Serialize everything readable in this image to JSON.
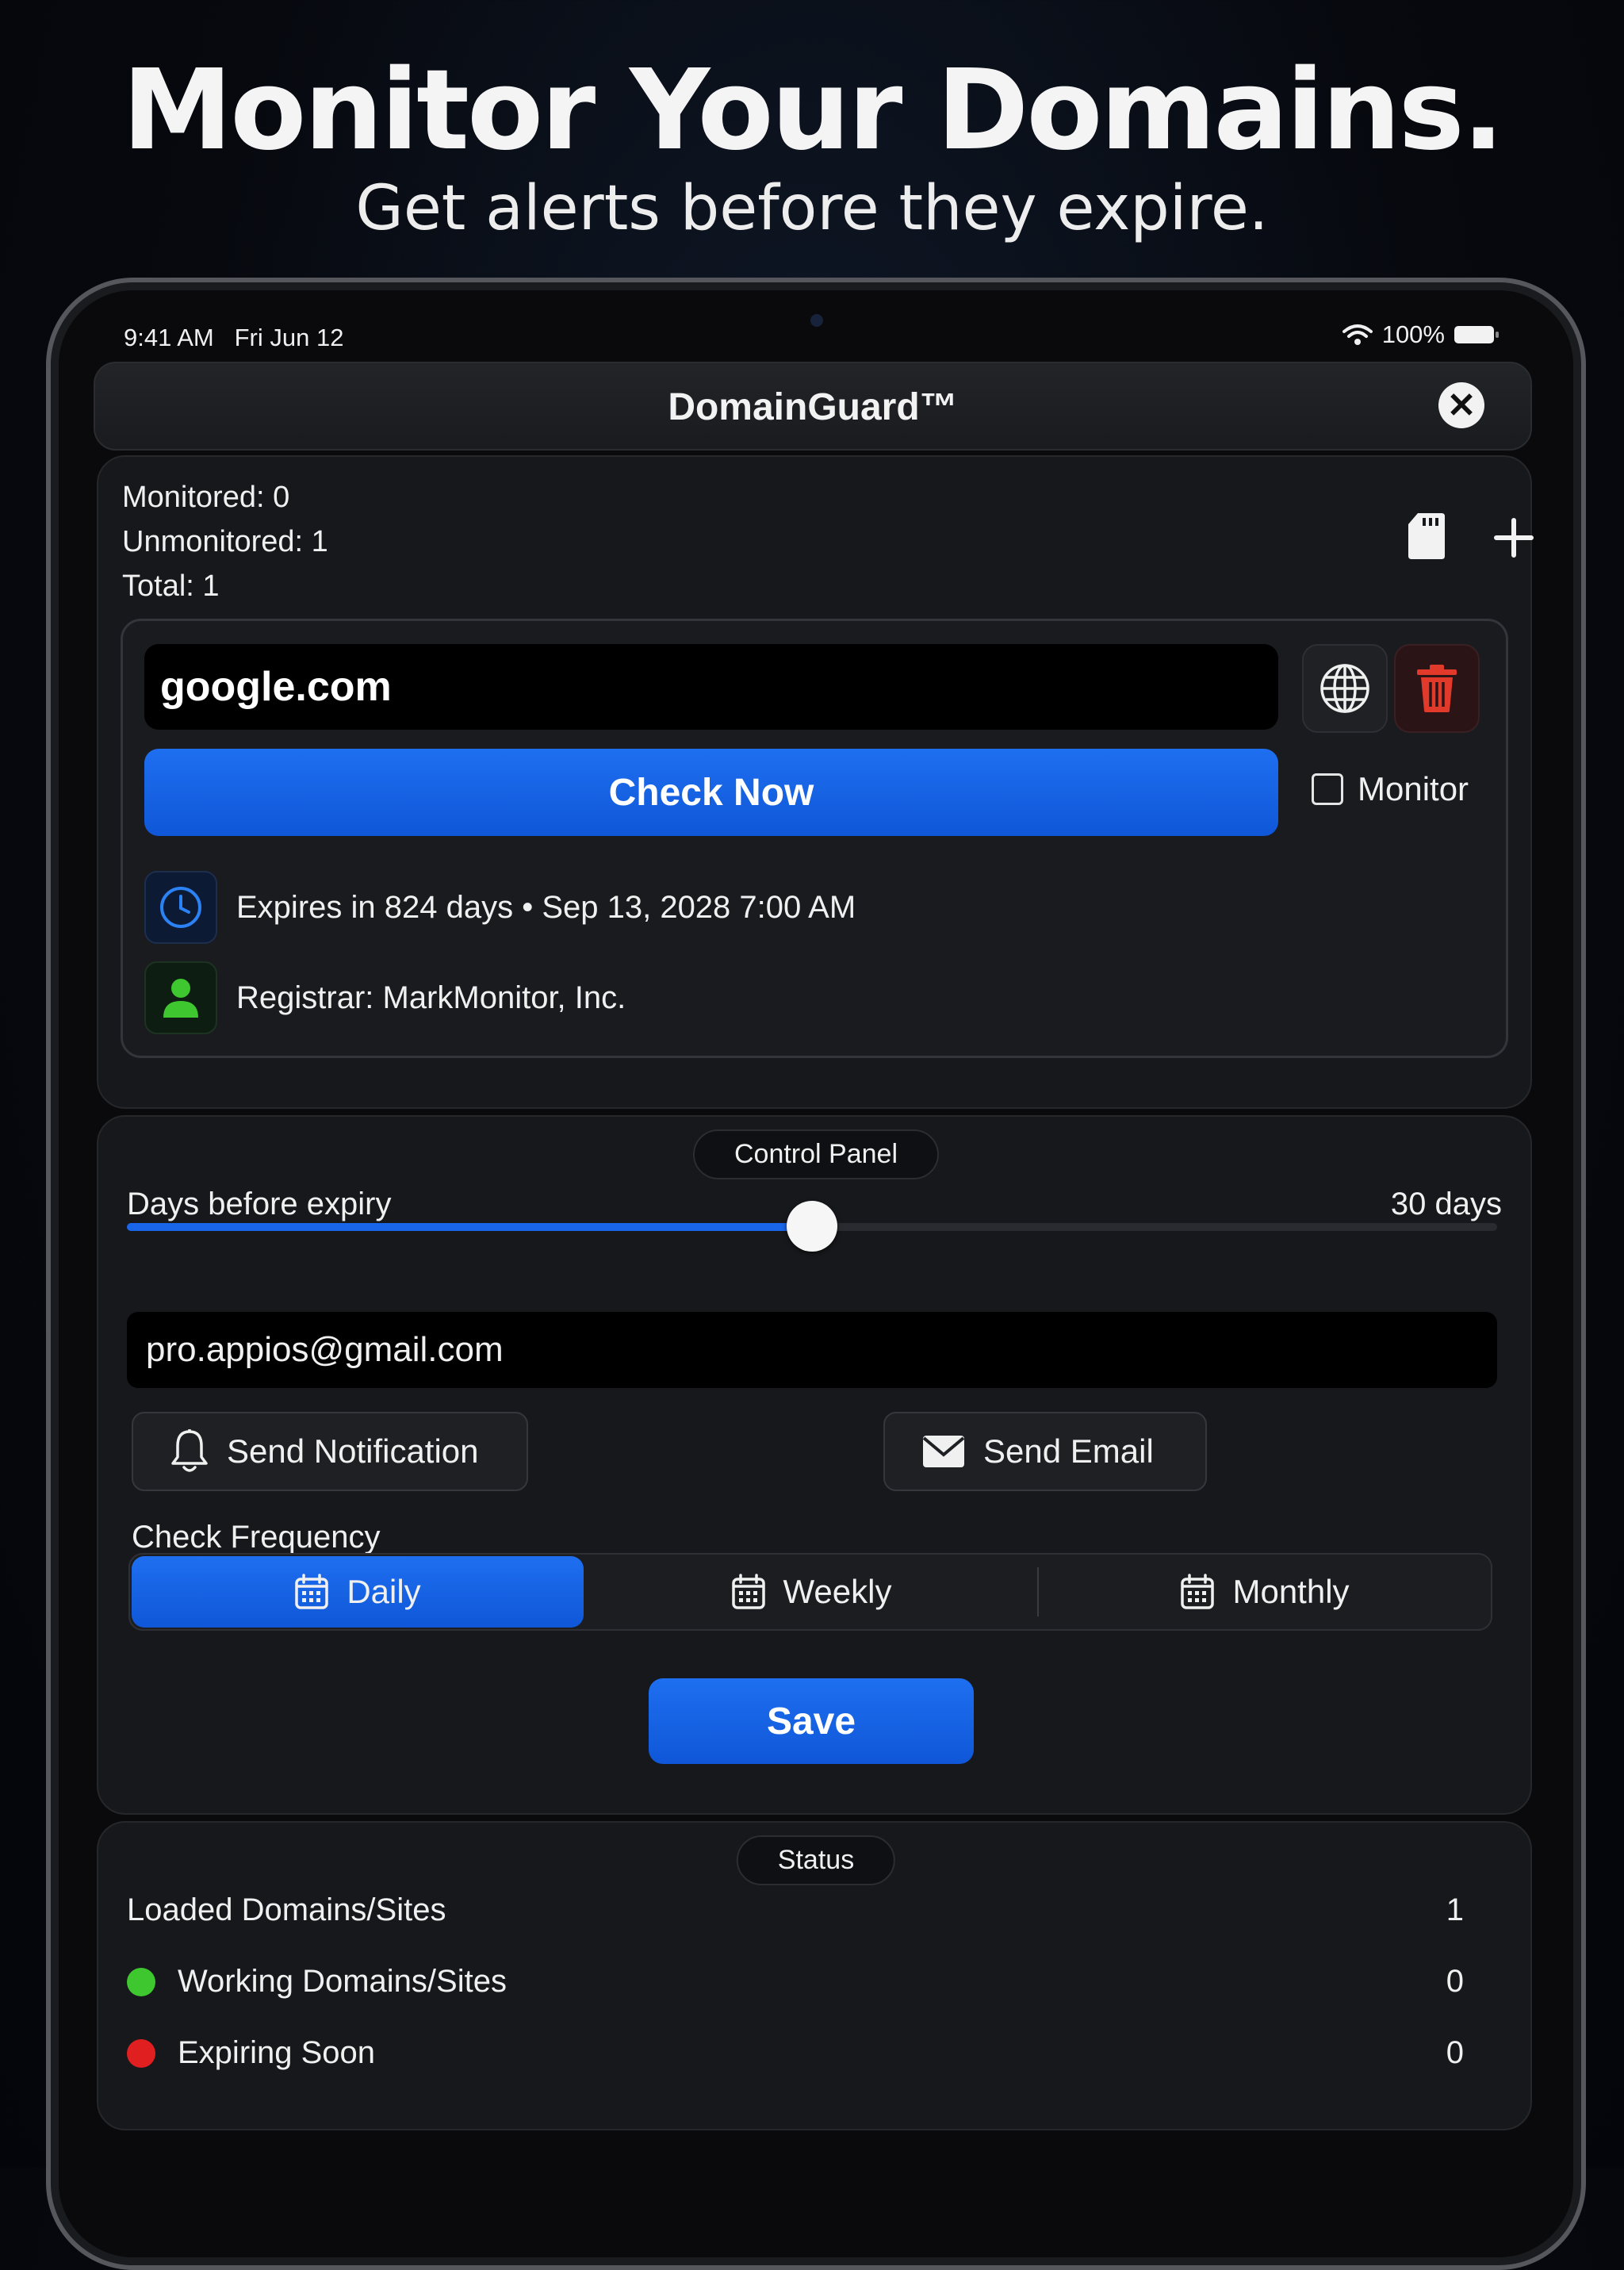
{
  "promo": {
    "headline": "Monitor Your Domains.",
    "subhead": "Get alerts before they expire."
  },
  "statusbar": {
    "time": "9:41 AM",
    "date": "Fri Jun 12",
    "battery": "100%"
  },
  "navbar": {
    "title": "DomainGuard™"
  },
  "summary": {
    "monitored": "Monitored: 0",
    "unmonitored": "Unmonitored: 1",
    "total": "Total: 1"
  },
  "domain_card": {
    "domain": "google.com",
    "check_label": "Check Now",
    "monitor_label": "Monitor",
    "monitor_checked": false,
    "expiry": "Expires in 824 days • Sep 13, 2028 7:00 AM",
    "registrar": "Registrar: MarkMonitor, Inc."
  },
  "control_panel": {
    "title": "Control Panel",
    "days_label": "Days before expiry",
    "days_value": "30 days",
    "slider_fraction": 0.5,
    "email": "pro.appios@gmail.com",
    "send_notification": "Send Notification",
    "send_email": "Send Email",
    "frequency_label": "Check Frequency",
    "frequency_options": [
      "Daily",
      "Weekly",
      "Monthly"
    ],
    "frequency_selected": "Daily",
    "save_label": "Save"
  },
  "status": {
    "title": "Status",
    "rows": [
      {
        "label": "Loaded Domains/Sites",
        "value": "1"
      },
      {
        "label": "Working Domains/Sites",
        "value": "0"
      },
      {
        "label": "Expiring Soon",
        "value": "0"
      }
    ]
  },
  "colors": {
    "accent": "#1a66e8",
    "working": "#3ec72f",
    "expiring": "#e02020",
    "trash": "#e23a2a",
    "clock": "#2b82f5",
    "person": "#3ec72f"
  }
}
